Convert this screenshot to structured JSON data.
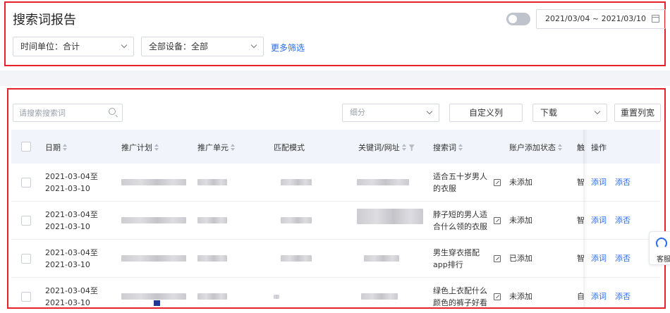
{
  "header": {
    "title": "搜索词报告",
    "date_range": "2021/03/04 ~ 2021/03/10",
    "filters": {
      "time_unit": "时间单位：合计",
      "device": "全部设备：全部",
      "more_filters": "更多筛选"
    }
  },
  "toolbar": {
    "search_placeholder": "请搜索搜索词",
    "breakdown_placeholder": "细分",
    "custom_columns": "自定义列",
    "download": "下载",
    "reset_width": "重置列宽"
  },
  "table": {
    "columns": {
      "date": "日期",
      "plan": "推广计划",
      "unit": "推广单元",
      "match_mode": "匹配模式",
      "keyword_url": "关键词/网址",
      "search_term": "搜索词",
      "add_status": "账户添加状态",
      "trigger": "触",
      "actions": "操作"
    },
    "action_add_word": "添词",
    "action_add_negative": "添否",
    "rows": [
      {
        "date": "2021-03-04至2021-03-10",
        "search_term": "适合五十岁男人的衣服",
        "status": "未添加",
        "match": "智"
      },
      {
        "date": "2021-03-04至2021-03-10",
        "search_term": "脖子短的男人适合什么领的衣服",
        "status": "未添加",
        "match": "智"
      },
      {
        "date": "2021-03-04至2021-03-10",
        "search_term": "男生穿衣搭配app排行",
        "status": "已添加",
        "match": "智"
      },
      {
        "date": "2021-03-04至2021-03-10",
        "search_term": "绿色上衣配什么颜色的裤子好看",
        "status": "未添加",
        "match": "自"
      }
    ]
  },
  "service": {
    "label": "客服"
  },
  "colors": {
    "accent": "#2a6ae9",
    "highlight_border": "#e8212a"
  }
}
